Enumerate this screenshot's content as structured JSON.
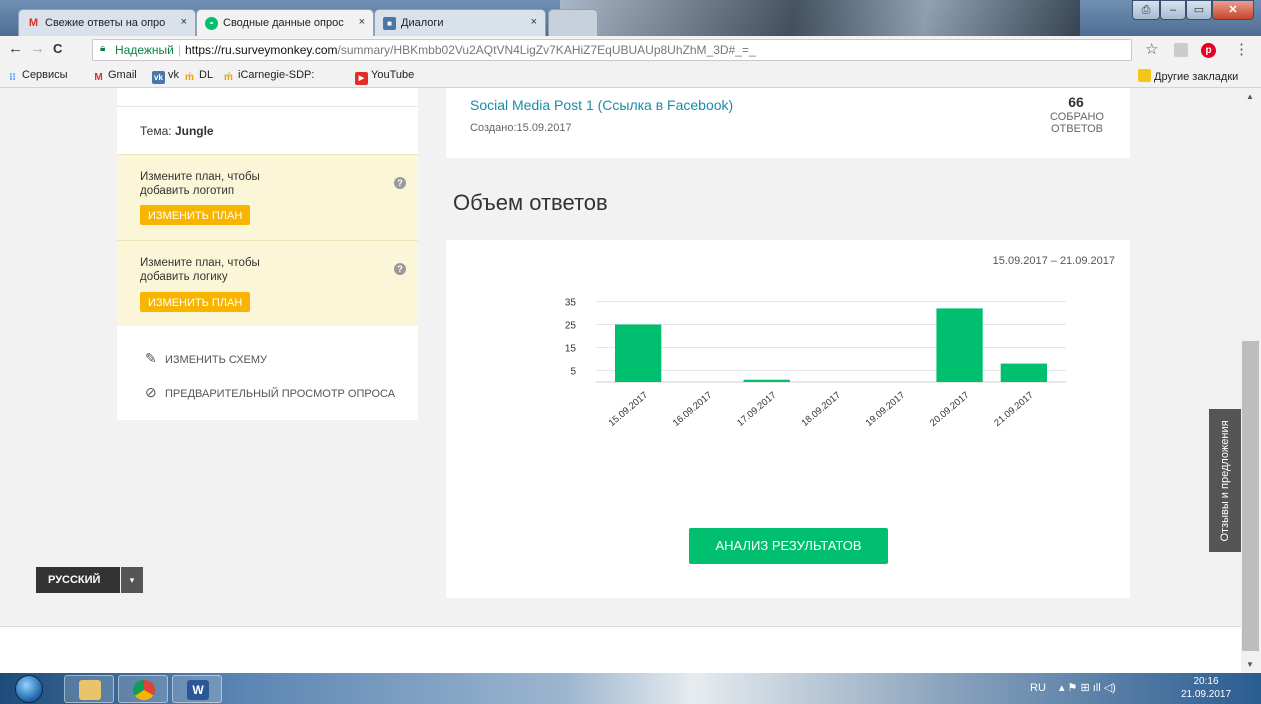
{
  "browser": {
    "tabs": [
      {
        "title": "Свежие ответы на опро",
        "icon": "gmail-icon",
        "close": "×"
      },
      {
        "title": "Сводные данные опрос",
        "icon": "surveymonkey-icon",
        "close": "×"
      },
      {
        "title": "Диалоги",
        "icon": "vk-icon",
        "close": "×"
      }
    ],
    "window_buttons": {
      "minimize": "–",
      "maximize": "▭",
      "close": "✕",
      "extra": "⎙"
    },
    "address": {
      "secure_label": "Надежный",
      "separator": "|",
      "host": "https://ru.surveymonkey.com",
      "path": "/summary/HBKmbb02Vu2AQtVN4LigZv7KAHiZ7EqUBUAUp8UhZhM_3D#_=_"
    },
    "nav_icons": {
      "back": "←",
      "forward": "→",
      "reload": "C",
      "star": "☆",
      "menu": "⋮"
    },
    "bookmarks": [
      {
        "label": "Сервисы",
        "icon": "apps-icon"
      },
      {
        "label": "Gmail",
        "icon": "gmail-icon"
      },
      {
        "label": "vk",
        "icon": "vk-icon"
      },
      {
        "label": "DL",
        "icon": "dl-icon"
      },
      {
        "label": "iCarnegie-SDP:",
        "icon": "dl-icon"
      },
      {
        "label": "YouTube",
        "icon": "youtube-icon"
      }
    ],
    "other_bookmarks": "Другие закладки"
  },
  "sidebar": {
    "theme_label": "Тема:",
    "theme_value": "Jungle",
    "upsells": [
      {
        "text": "Измените план, чтобы добавить логотип",
        "button": "ИЗМЕНИТЬ ПЛАН",
        "help": "?"
      },
      {
        "text": "Измените план, чтобы добавить логику",
        "button": "ИЗМЕНИТЬ ПЛАН",
        "help": "?"
      }
    ],
    "links": [
      {
        "label": "ИЗМЕНИТЬ СХЕМУ",
        "icon": "edit-icon"
      },
      {
        "label": "ПРЕДВАРИТЕЛЬНЫЙ ПРОСМОТР ОПРОСА",
        "icon": "link-icon"
      }
    ]
  },
  "collector": {
    "title": "Social Media Post 1 (Ссылка в Facebook)",
    "created": "Создано:15.09.2017",
    "count": "66",
    "count_label_1": "СОБРАНО",
    "count_label_2": "ОТВЕТОВ"
  },
  "section_title": "Объем ответов",
  "date_range": "15.09.2017 – 21.09.2017",
  "analyze_button": "АНАЛИЗ РЕЗУЛЬТАТОВ",
  "chart_data": {
    "type": "bar",
    "categories": [
      "15.09.2017",
      "16.09.2017",
      "17.09.2017",
      "18.09.2017",
      "19.09.2017",
      "20.09.2017",
      "21.09.2017"
    ],
    "values": [
      25,
      0,
      1,
      0,
      0,
      32,
      8
    ],
    "ytick_labels": [
      "35",
      "25",
      "15",
      "5"
    ],
    "yticks": [
      35,
      25,
      15,
      5
    ],
    "ylim": [
      0,
      40
    ],
    "grid": true,
    "color": "#00bf6f"
  },
  "footer": {
    "language": "РУССКИЙ",
    "caret": "▾"
  },
  "feedback_tab": "Отзывы и предложения",
  "taskbar": {
    "apps": [
      {
        "icon": "explorer-icon"
      },
      {
        "icon": "chrome-icon"
      },
      {
        "icon": "word-icon",
        "glyph": "W"
      }
    ],
    "tray_lang": "RU",
    "tray_icons": "▴  ⚑  ⊞  ıll  ◁)",
    "time": "20:16",
    "date": "21.09.2017"
  }
}
